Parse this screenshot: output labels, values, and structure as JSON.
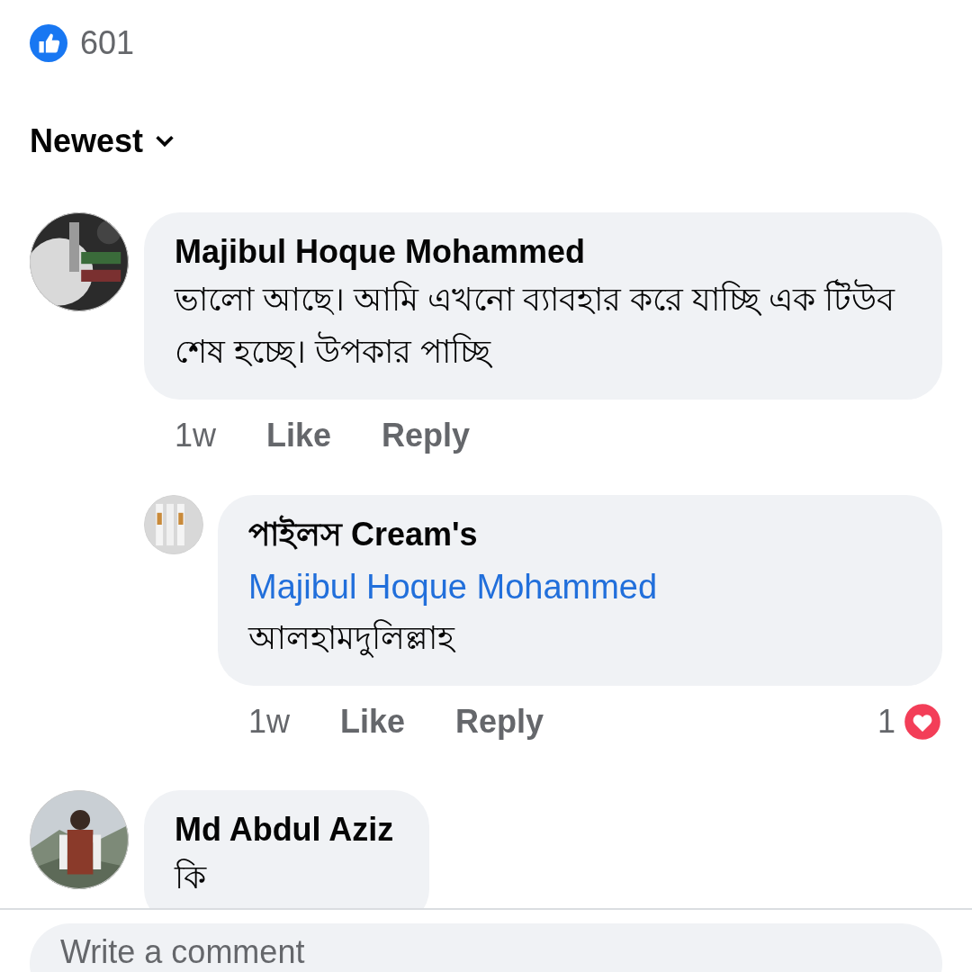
{
  "reactions": {
    "count": "601"
  },
  "sort": {
    "label": "Newest"
  },
  "comments": [
    {
      "author": "Majibul Hoque Mohammed",
      "text": "ভালো আছে। আমি এখনো ব্যাবহার করে যাচ্ছি এক টিউব শেষ হচ্ছে। উপকার পাচ্ছি",
      "time": "1w",
      "like": "Like",
      "reply": "Reply",
      "children": [
        {
          "author": "পাইলস Cream's",
          "mention": "Majibul Hoque Mohammed",
          "text": "আলহামদুলিল্লাহ",
          "time": "1w",
          "like": "Like",
          "reply": "Reply",
          "reaction_count": "1"
        }
      ]
    },
    {
      "author": "Md Abdul Aziz",
      "text": "কি"
    }
  ],
  "composer": {
    "placeholder": "Write a comment"
  }
}
